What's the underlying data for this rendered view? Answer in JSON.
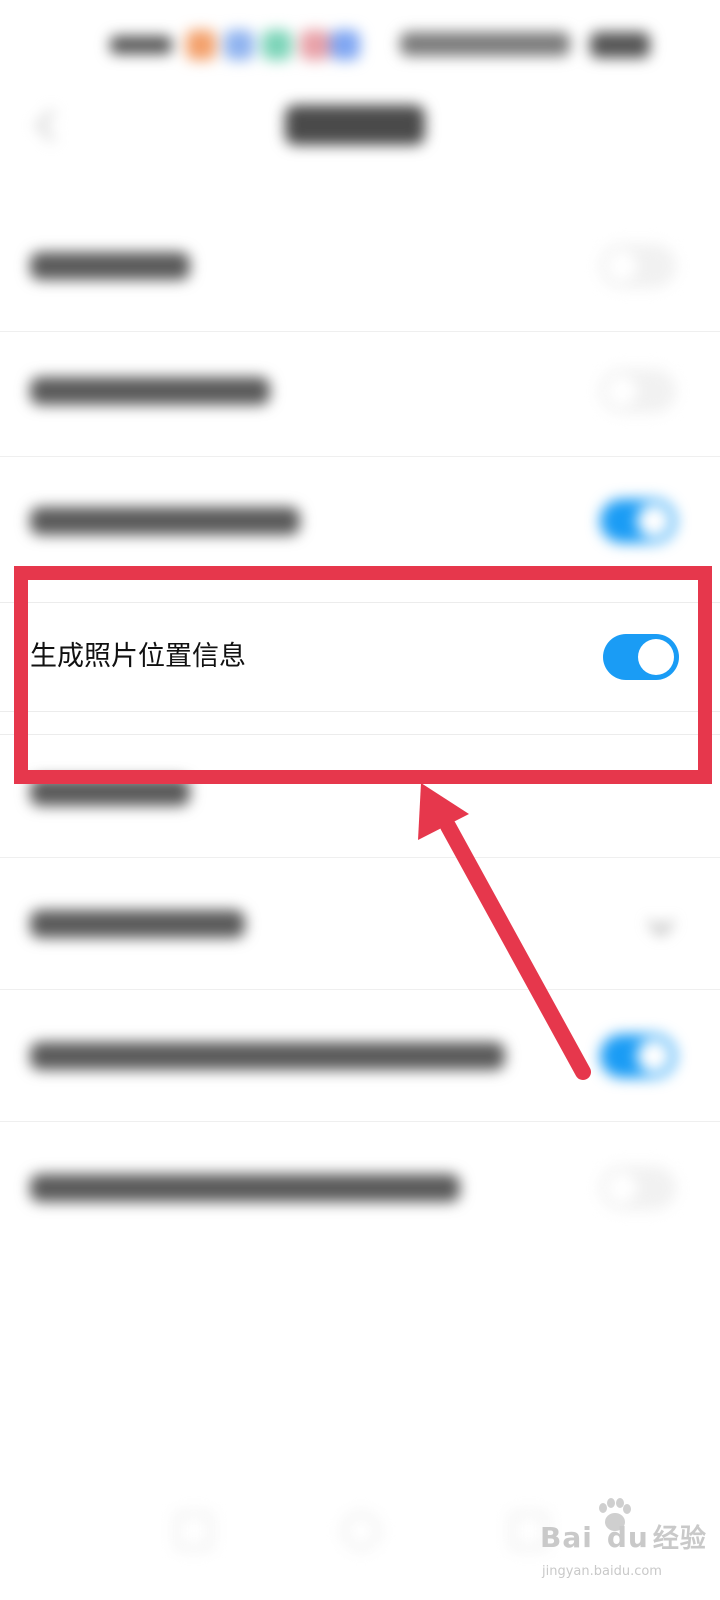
{
  "status_bar": {
    "app_icon_colors": [
      "#f3a06b",
      "#8fb3ef",
      "#7cd4b8",
      "#e8a1a8",
      "#7fa6f2"
    ]
  },
  "header": {
    "back_icon": "chevron-left-icon"
  },
  "settings": {
    "highlighted_item": {
      "label": "生成照片位置信息",
      "toggle_on": true
    },
    "toggle_on_color": "#1a9cf5"
  },
  "annotation": {
    "box_color": "#e6374c",
    "arrow_color": "#e6374c"
  },
  "watermark": {
    "logo_text_left": "Bai",
    "logo_text_right": "du",
    "logo_suffix": "经验",
    "sub_text": "jingyan.baidu.com"
  }
}
